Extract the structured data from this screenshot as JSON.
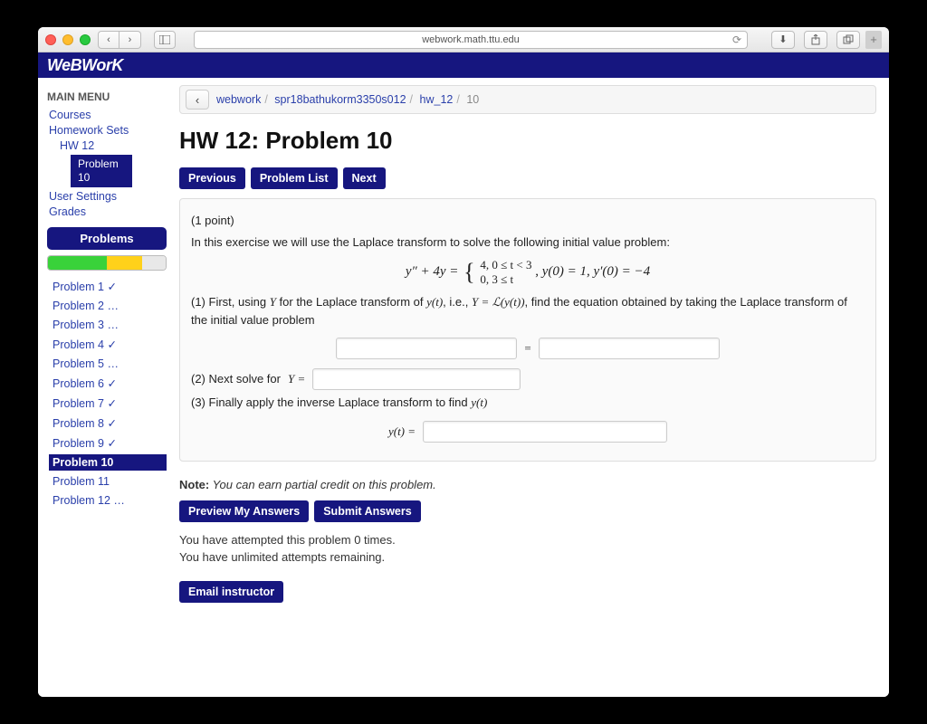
{
  "browser": {
    "url": "webwork.math.ttu.edu"
  },
  "brand": "WeBWorK",
  "sidebar": {
    "title": "MAIN MENU",
    "links": {
      "courses": "Courses",
      "hwsets": "Homework Sets",
      "hw12": "HW 12",
      "current": "Problem 10",
      "usersettings": "User Settings",
      "grades": "Grades"
    },
    "problems_header": "Problems",
    "progress": {
      "green": 50,
      "yellow": 30,
      "grey": 20
    },
    "problems": [
      {
        "label": "Problem 1",
        "mark": "✓"
      },
      {
        "label": "Problem 2",
        "mark": "…"
      },
      {
        "label": "Problem 3",
        "mark": "…"
      },
      {
        "label": "Problem 4",
        "mark": "✓"
      },
      {
        "label": "Problem 5",
        "mark": "…"
      },
      {
        "label": "Problem 6",
        "mark": "✓"
      },
      {
        "label": "Problem 7",
        "mark": "✓"
      },
      {
        "label": "Problem 8",
        "mark": "✓"
      },
      {
        "label": "Problem 9",
        "mark": "✓"
      },
      {
        "label": "Problem 10",
        "mark": ""
      },
      {
        "label": "Problem 11",
        "mark": ""
      },
      {
        "label": "Problem 12",
        "mark": "…"
      }
    ],
    "active_index": 9
  },
  "breadcrumb": {
    "parts": [
      "webwork",
      "spr18bathukorm3350s012",
      "hw_12",
      "10"
    ]
  },
  "page": {
    "title": "HW 12: Problem 10",
    "prev": "Previous",
    "list": "Problem List",
    "next": "Next",
    "points": "(1 point)",
    "intro": "In this exercise we will use the Laplace transform to solve the following initial value problem:",
    "eq_lhs": "y″ + 4y =",
    "eq_piece1": "4,   0 ≤ t < 3",
    "eq_piece2": "0,   3 ≤ t",
    "eq_comma": ",     ",
    "eq_ic": "y(0) = 1, y′(0) = −4",
    "step1a": "(1) First, using ",
    "step1b": " for the Laplace transform of ",
    "step1c": ", i.e., ",
    "step1d": ", find the equation obtained by taking the Laplace transform of the initial value problem",
    "Yvar": "Y",
    "yoft": "y(t)",
    "YeqLy": "Y = ℒ(y(t))",
    "equals": "=",
    "step2": "(2) Next solve for ",
    "Yeq": "Y =",
    "step3": "(3) Finally apply the inverse Laplace transform to find ",
    "yteq": "y(t) =",
    "note_label": "Note:",
    "note_text": " You can earn partial credit on this problem.",
    "preview": "Preview My Answers",
    "submit": "Submit Answers",
    "att1": "You have attempted this problem 0 times.",
    "att2": "You have unlimited attempts remaining.",
    "email": "Email instructor"
  }
}
